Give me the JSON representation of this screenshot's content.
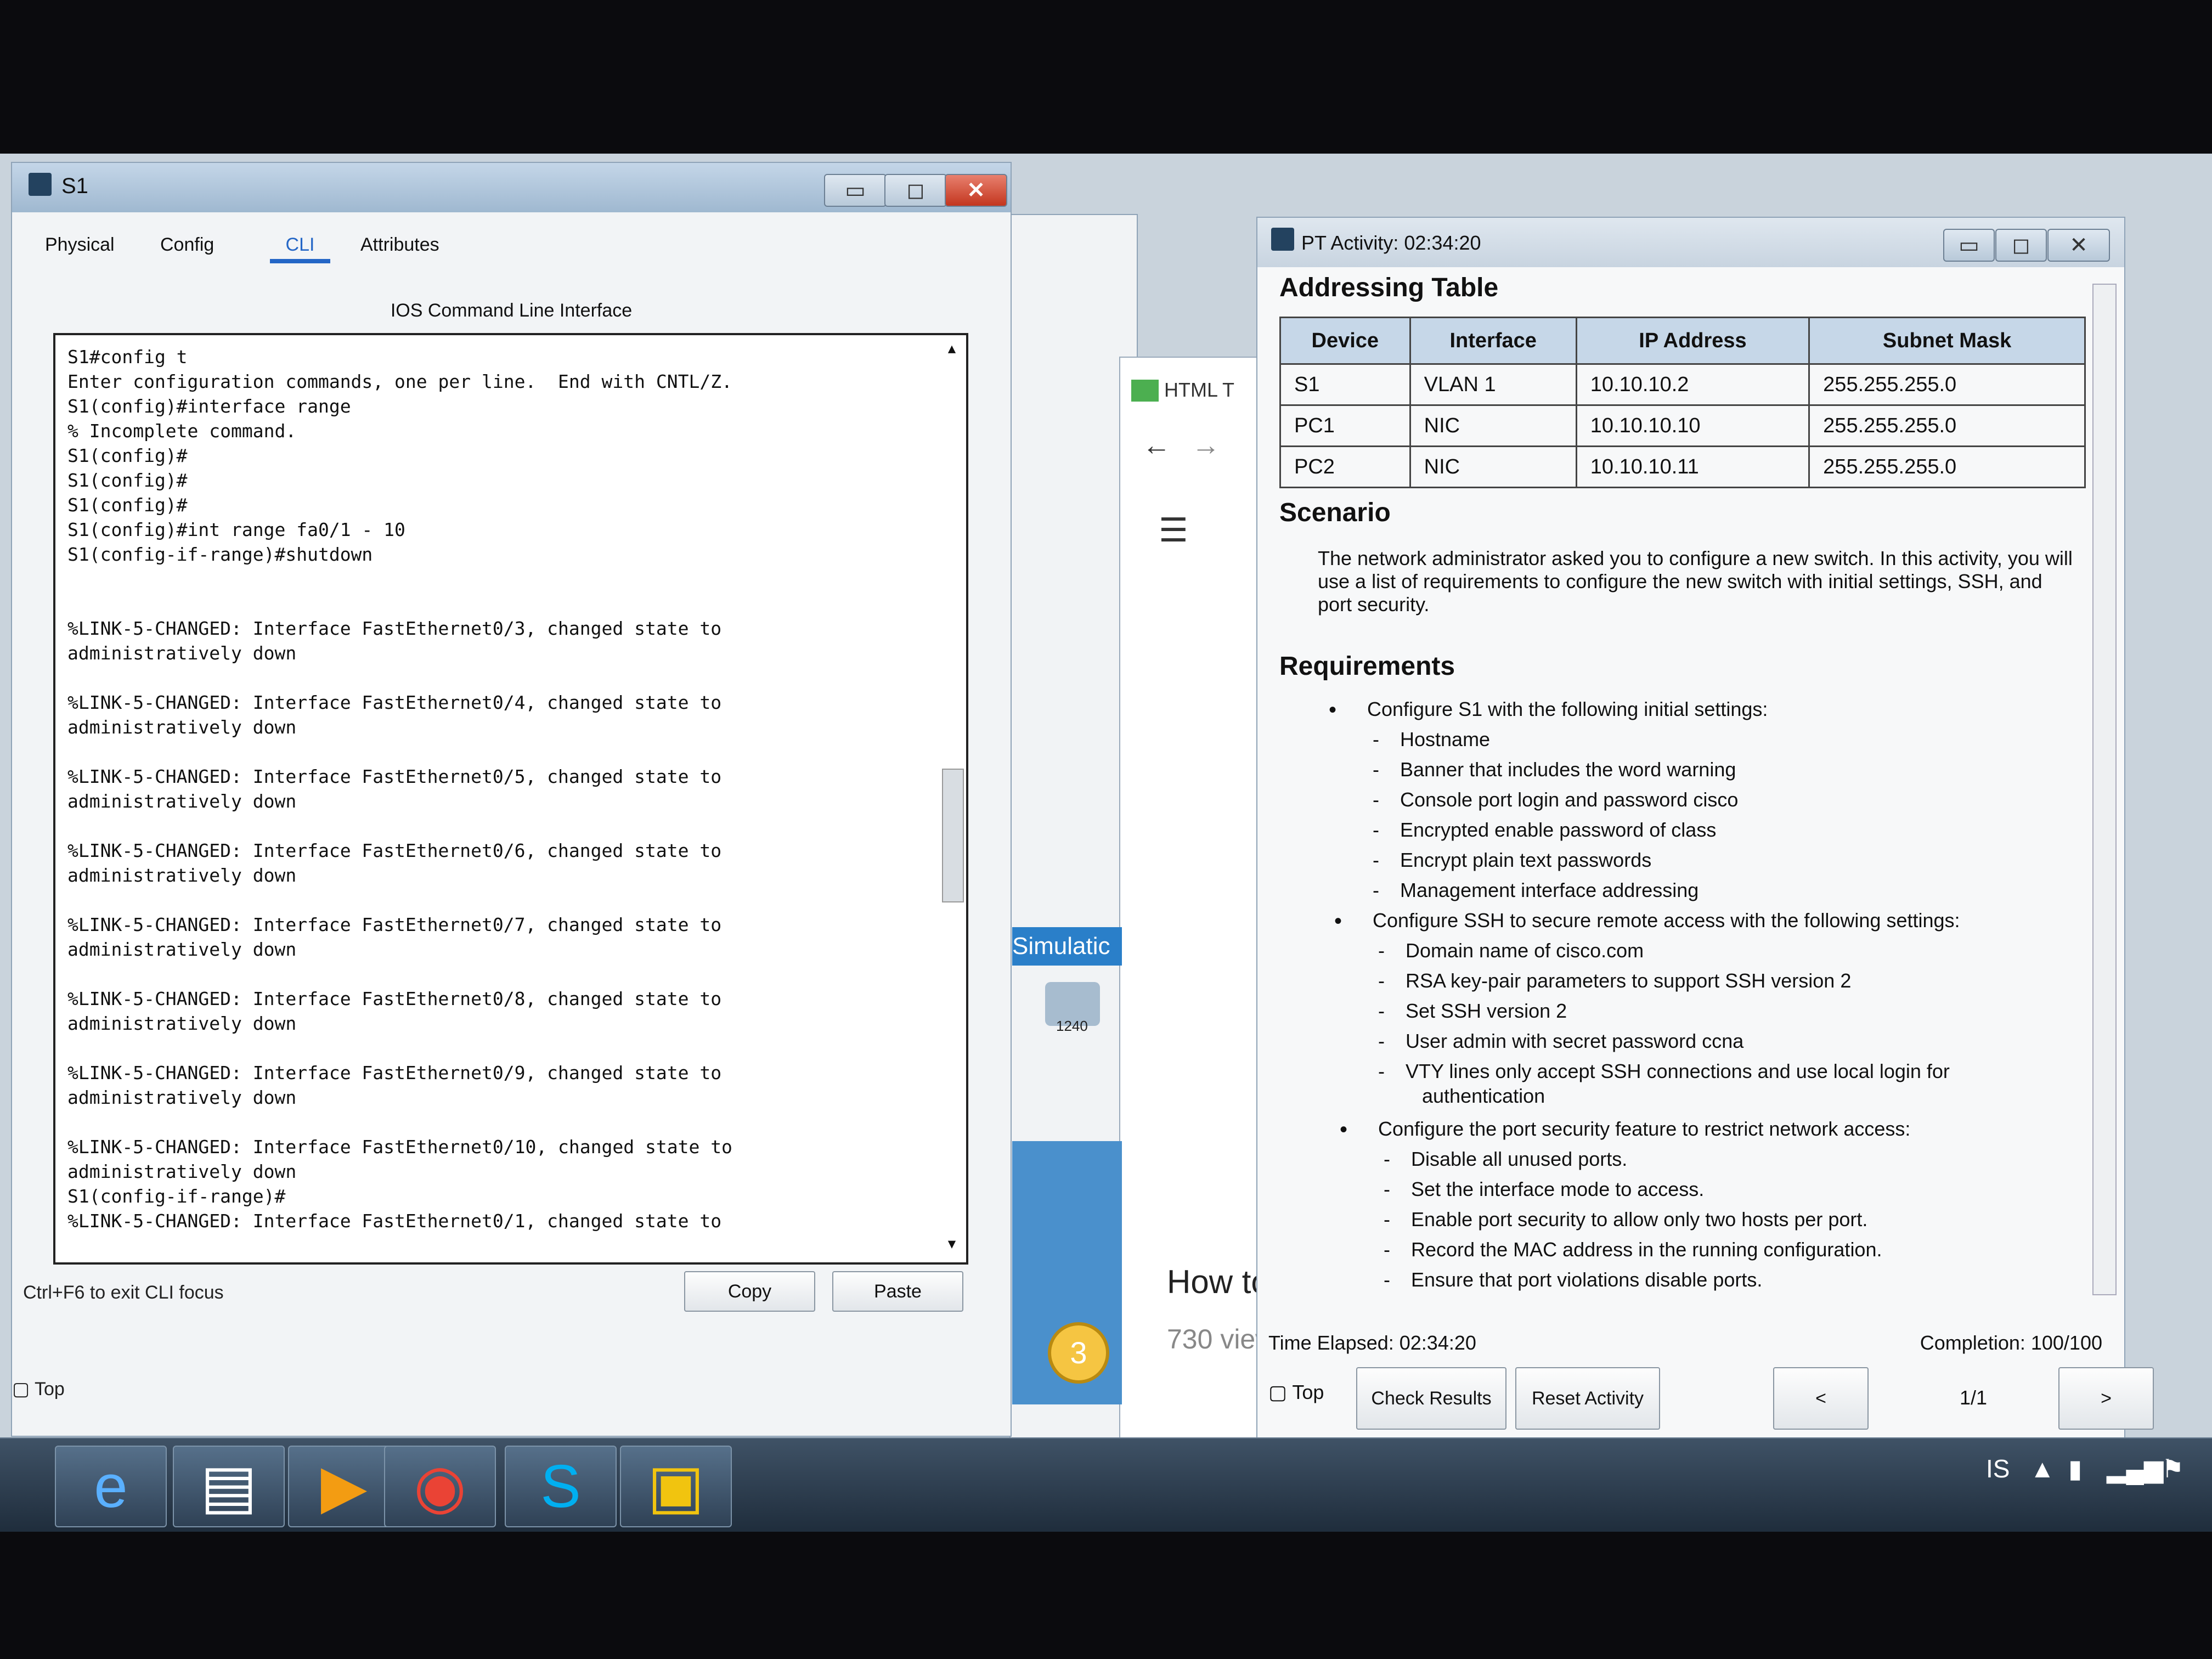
{
  "s1_window": {
    "title": "S1",
    "tabs": [
      "Physical",
      "Config",
      "CLI",
      "Attributes"
    ],
    "active_tab": "CLI",
    "cli_caption": "IOS Command Line Interface",
    "cli_lines": [
      "S1#config t",
      "Enter configuration commands, one per line.  End with CNTL/Z.",
      "S1(config)#interface range",
      "% Incomplete command.",
      "S1(config)#",
      "S1(config)#",
      "S1(config)#",
      "S1(config)#int range fa0/1 - 10",
      "S1(config-if-range)#shutdown",
      "",
      "",
      "%LINK-5-CHANGED: Interface FastEthernet0/3, changed state to",
      "administratively down",
      "",
      "%LINK-5-CHANGED: Interface FastEthernet0/4, changed state to",
      "administratively down",
      "",
      "%LINK-5-CHANGED: Interface FastEthernet0/5, changed state to",
      "administratively down",
      "",
      "%LINK-5-CHANGED: Interface FastEthernet0/6, changed state to",
      "administratively down",
      "",
      "%LINK-5-CHANGED: Interface FastEthernet0/7, changed state to",
      "administratively down",
      "",
      "%LINK-5-CHANGED: Interface FastEthernet0/8, changed state to",
      "administratively down",
      "",
      "%LINK-5-CHANGED: Interface FastEthernet0/9, changed state to",
      "administratively down",
      "",
      "%LINK-5-CHANGED: Interface FastEthernet0/10, changed state to",
      "administratively down",
      "S1(config-if-range)#",
      "%LINK-5-CHANGED: Interface FastEthernet0/1, changed state to"
    ],
    "hint": "Ctrl+F6 to exit CLI focus",
    "copy_label": "Copy",
    "paste_label": "Paste",
    "top_label": "Top"
  },
  "middle": {
    "browser_tab": "HTML T",
    "simulation_label": "Simulatic",
    "device_label": "1240",
    "how_to": "How to",
    "views": "730 view",
    "badge": "3"
  },
  "pt_window": {
    "title": "PT Activity: 02:34:20",
    "addressing_title": "Addressing Table",
    "table_headers": [
      "Device",
      "Interface",
      "IP Address",
      "Subnet Mask"
    ],
    "table_rows": [
      [
        "S1",
        "VLAN 1",
        "10.10.10.2",
        "255.255.255.0"
      ],
      [
        "PC1",
        "NIC",
        "10.10.10.10",
        "255.255.255.0"
      ],
      [
        "PC2",
        "NIC",
        "10.10.10.11",
        "255.255.255.0"
      ]
    ],
    "scenario_title": "Scenario",
    "scenario_text": "The network administrator asked you to configure a new switch. In this activity, you will use a list of requirements to configure the new switch with initial settings, SSH, and port security.",
    "requirements_title": "Requirements",
    "req1": "Configure S1 with the following initial settings:",
    "req1_items": [
      "Hostname",
      "Banner that includes the word warning",
      "Console port login and password cisco",
      "Encrypted enable password of class",
      "Encrypt plain text passwords",
      "Management interface addressing"
    ],
    "req2": "Configure SSH to secure remote access with the following settings:",
    "req2_items": [
      "Domain name of cisco.com",
      "RSA key-pair parameters to support SSH version 2",
      "Set SSH version 2",
      "User admin with secret password ccna",
      "VTY lines only accept SSH connections and use local login for",
      "authentication"
    ],
    "req3": "Configure the port security feature to restrict network access:",
    "req3_items": [
      "Disable all unused ports.",
      "Set the interface mode to access.",
      "Enable port security to allow only two hosts per port.",
      "Record the MAC address in the running configuration.",
      "Ensure that port violations disable ports."
    ],
    "time_elapsed": "Time Elapsed: 02:34:20",
    "completion": "Completion: 100/100",
    "top_label": "Top",
    "check_results": "Check Results",
    "reset_activity": "Reset Activity",
    "prev": "<",
    "page": "1/1",
    "next": ">"
  },
  "taskbar": {
    "lang": "IS"
  }
}
